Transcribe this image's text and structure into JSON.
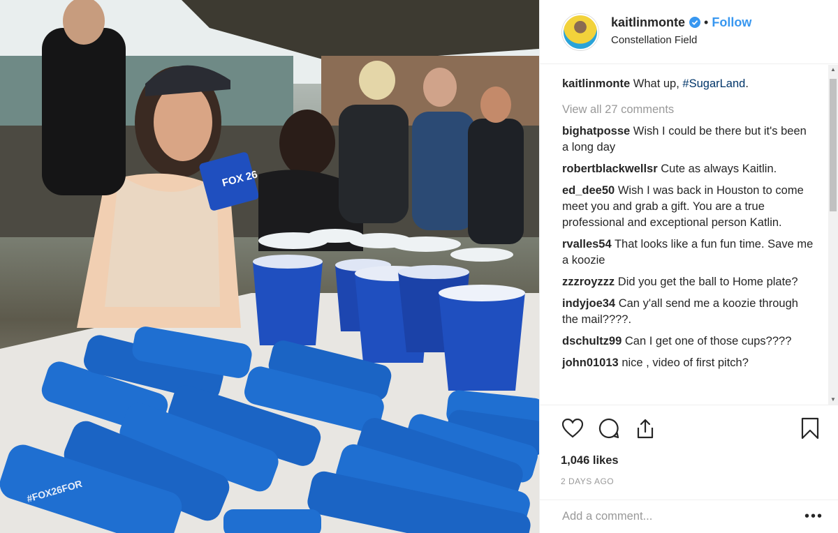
{
  "post": {
    "username": "kaitlinmonte",
    "location": "Constellation Field",
    "follow_label": "Follow",
    "separator": "•",
    "caption": {
      "text_before": "What up, ",
      "hashtag": "#SugarLand",
      "text_after": "."
    },
    "view_all_comments": "View all 27 comments",
    "comments": [
      {
        "user": "bighatposse",
        "text": "Wish I could be there but it's been a long day"
      },
      {
        "user": "robertblackwellsr",
        "text": "Cute as always Kaitlin."
      },
      {
        "user": "ed_dee50",
        "text": "Wish I was back in Houston to come meet you and grab a gift. You are a true professional and exceptional person Katlin."
      },
      {
        "user": "rvalles54",
        "text": "That looks like a fun fun time. Save me a koozie"
      },
      {
        "user": "zzzroyzzz",
        "text": "Did you get the ball to Home plate?"
      },
      {
        "user": "indyjoe34",
        "text": "Can y'all send me a koozie through the mail????."
      },
      {
        "user": "dschultz99",
        "text": "Can I get one of those cups????"
      },
      {
        "user": "john01013",
        "text": "nice , video of first pitch?"
      }
    ],
    "likes": "1,046 likes",
    "date": "2 DAYS AGO",
    "add_comment_placeholder": "Add a comment...",
    "more_label": "•••"
  },
  "photo": {
    "cup_logo": "FOX 26",
    "koozie_text": "#FOX26FOR"
  },
  "colors": {
    "accent": "#3897f0",
    "hashtag": "#003569",
    "muted": "#999999",
    "cup_blue": "#1f4fbf",
    "koozie_blue": "#1f6fd1"
  },
  "icons": {
    "like": "heart-icon",
    "comment": "comment-icon",
    "share": "share-icon",
    "save": "bookmark-icon",
    "verified": "verified-badge-icon"
  }
}
